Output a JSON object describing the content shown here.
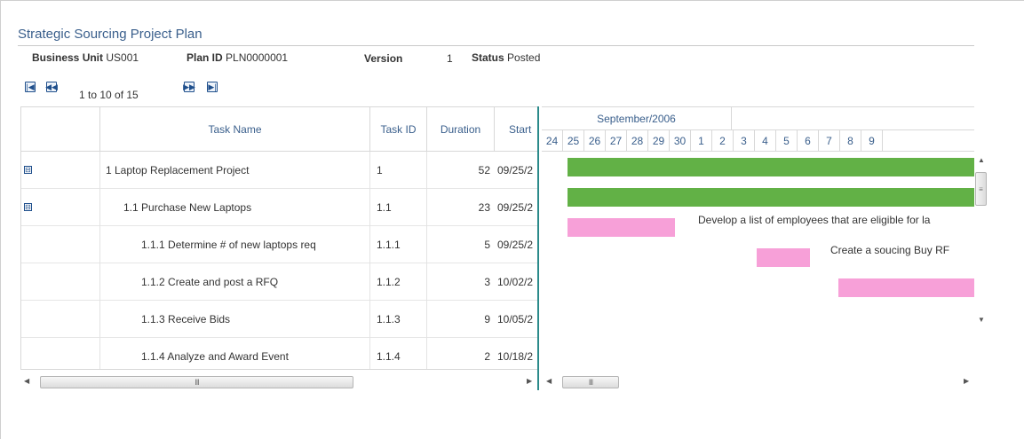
{
  "page": {
    "title": "Strategic Sourcing Project Plan"
  },
  "header": {
    "business_unit_label": "Business Unit",
    "business_unit_value": "US001",
    "plan_id_label": "Plan ID",
    "plan_id_value": "PLN0000001",
    "version_label": "Version",
    "version_value": "1",
    "status_label": "Status",
    "status_value": "Posted"
  },
  "pager": {
    "first_icon": "first-page-icon",
    "prev_icon": "previous-page-icon",
    "next_icon": "next-page-icon",
    "last_icon": "last-page-icon",
    "range_text": "1 to 10 of 15"
  },
  "grid": {
    "columns": {
      "task_name": "Task Name",
      "task_id": "Task ID",
      "duration": "Duration",
      "start": "Start"
    },
    "rows": [
      {
        "toggle": "⊟",
        "name": "1 Laptop Replacement Project",
        "id": "1",
        "duration": "52",
        "start": "09/25/2"
      },
      {
        "toggle": "⊟",
        "name": "1.1 Purchase New Laptops",
        "id": "1.1",
        "duration": "23",
        "start": "09/25/2"
      },
      {
        "toggle": "",
        "name": "1.1.1 Determine # of new laptops req",
        "id": "1.1.1",
        "duration": "5",
        "start": "09/25/2"
      },
      {
        "toggle": "",
        "name": "1.1.2 Create and post a RFQ",
        "id": "1.1.2",
        "duration": "3",
        "start": "10/02/2"
      },
      {
        "toggle": "",
        "name": "1.1.3 Receive Bids",
        "id": "1.1.3",
        "duration": "9",
        "start": "10/05/2"
      },
      {
        "toggle": "",
        "name": "1.1.4 Analyze and Award Event",
        "id": "1.1.4",
        "duration": "2",
        "start": "10/18/2"
      }
    ]
  },
  "gantt": {
    "month": "September/2006",
    "days": [
      "24",
      "25",
      "26",
      "27",
      "28",
      "29",
      "30",
      "1",
      "2",
      "3",
      "4",
      "5",
      "6",
      "7",
      "8",
      "9"
    ],
    "colors": {
      "summary": "#62b146",
      "task": "#f7a0d8"
    },
    "notes": {
      "note_1": "Develop a list of employees that are eligible for la",
      "note_2": "Create a soucing Buy RF"
    }
  },
  "scroll": {
    "grip": "III",
    "grip_v": "≡"
  }
}
